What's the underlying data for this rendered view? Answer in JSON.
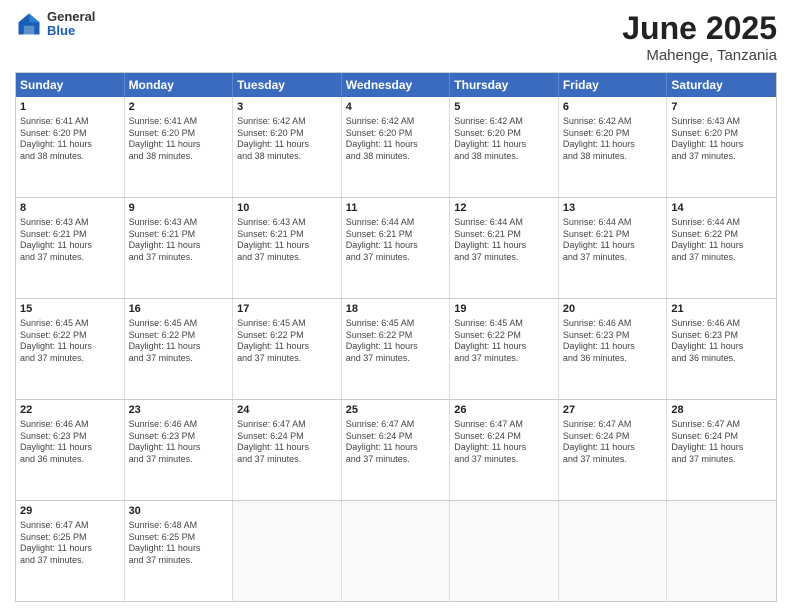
{
  "logo": {
    "general": "General",
    "blue": "Blue"
  },
  "title": {
    "month": "June 2025",
    "location": "Mahenge, Tanzania"
  },
  "header_days": [
    "Sunday",
    "Monday",
    "Tuesday",
    "Wednesday",
    "Thursday",
    "Friday",
    "Saturday"
  ],
  "weeks": [
    [
      {
        "day": "1",
        "lines": [
          "Sunrise: 6:41 AM",
          "Sunset: 6:20 PM",
          "Daylight: 11 hours",
          "and 38 minutes."
        ]
      },
      {
        "day": "2",
        "lines": [
          "Sunrise: 6:41 AM",
          "Sunset: 6:20 PM",
          "Daylight: 11 hours",
          "and 38 minutes."
        ]
      },
      {
        "day": "3",
        "lines": [
          "Sunrise: 6:42 AM",
          "Sunset: 6:20 PM",
          "Daylight: 11 hours",
          "and 38 minutes."
        ]
      },
      {
        "day": "4",
        "lines": [
          "Sunrise: 6:42 AM",
          "Sunset: 6:20 PM",
          "Daylight: 11 hours",
          "and 38 minutes."
        ]
      },
      {
        "day": "5",
        "lines": [
          "Sunrise: 6:42 AM",
          "Sunset: 6:20 PM",
          "Daylight: 11 hours",
          "and 38 minutes."
        ]
      },
      {
        "day": "6",
        "lines": [
          "Sunrise: 6:42 AM",
          "Sunset: 6:20 PM",
          "Daylight: 11 hours",
          "and 38 minutes."
        ]
      },
      {
        "day": "7",
        "lines": [
          "Sunrise: 6:43 AM",
          "Sunset: 6:20 PM",
          "Daylight: 11 hours",
          "and 37 minutes."
        ]
      }
    ],
    [
      {
        "day": "8",
        "lines": [
          "Sunrise: 6:43 AM",
          "Sunset: 6:21 PM",
          "Daylight: 11 hours",
          "and 37 minutes."
        ]
      },
      {
        "day": "9",
        "lines": [
          "Sunrise: 6:43 AM",
          "Sunset: 6:21 PM",
          "Daylight: 11 hours",
          "and 37 minutes."
        ]
      },
      {
        "day": "10",
        "lines": [
          "Sunrise: 6:43 AM",
          "Sunset: 6:21 PM",
          "Daylight: 11 hours",
          "and 37 minutes."
        ]
      },
      {
        "day": "11",
        "lines": [
          "Sunrise: 6:44 AM",
          "Sunset: 6:21 PM",
          "Daylight: 11 hours",
          "and 37 minutes."
        ]
      },
      {
        "day": "12",
        "lines": [
          "Sunrise: 6:44 AM",
          "Sunset: 6:21 PM",
          "Daylight: 11 hours",
          "and 37 minutes."
        ]
      },
      {
        "day": "13",
        "lines": [
          "Sunrise: 6:44 AM",
          "Sunset: 6:21 PM",
          "Daylight: 11 hours",
          "and 37 minutes."
        ]
      },
      {
        "day": "14",
        "lines": [
          "Sunrise: 6:44 AM",
          "Sunset: 6:22 PM",
          "Daylight: 11 hours",
          "and 37 minutes."
        ]
      }
    ],
    [
      {
        "day": "15",
        "lines": [
          "Sunrise: 6:45 AM",
          "Sunset: 6:22 PM",
          "Daylight: 11 hours",
          "and 37 minutes."
        ]
      },
      {
        "day": "16",
        "lines": [
          "Sunrise: 6:45 AM",
          "Sunset: 6:22 PM",
          "Daylight: 11 hours",
          "and 37 minutes."
        ]
      },
      {
        "day": "17",
        "lines": [
          "Sunrise: 6:45 AM",
          "Sunset: 6:22 PM",
          "Daylight: 11 hours",
          "and 37 minutes."
        ]
      },
      {
        "day": "18",
        "lines": [
          "Sunrise: 6:45 AM",
          "Sunset: 6:22 PM",
          "Daylight: 11 hours",
          "and 37 minutes."
        ]
      },
      {
        "day": "19",
        "lines": [
          "Sunrise: 6:45 AM",
          "Sunset: 6:22 PM",
          "Daylight: 11 hours",
          "and 37 minutes."
        ]
      },
      {
        "day": "20",
        "lines": [
          "Sunrise: 6:46 AM",
          "Sunset: 6:23 PM",
          "Daylight: 11 hours",
          "and 36 minutes."
        ]
      },
      {
        "day": "21",
        "lines": [
          "Sunrise: 6:46 AM",
          "Sunset: 6:23 PM",
          "Daylight: 11 hours",
          "and 36 minutes."
        ]
      }
    ],
    [
      {
        "day": "22",
        "lines": [
          "Sunrise: 6:46 AM",
          "Sunset: 6:23 PM",
          "Daylight: 11 hours",
          "and 36 minutes."
        ]
      },
      {
        "day": "23",
        "lines": [
          "Sunrise: 6:46 AM",
          "Sunset: 6:23 PM",
          "Daylight: 11 hours",
          "and 37 minutes."
        ]
      },
      {
        "day": "24",
        "lines": [
          "Sunrise: 6:47 AM",
          "Sunset: 6:24 PM",
          "Daylight: 11 hours",
          "and 37 minutes."
        ]
      },
      {
        "day": "25",
        "lines": [
          "Sunrise: 6:47 AM",
          "Sunset: 6:24 PM",
          "Daylight: 11 hours",
          "and 37 minutes."
        ]
      },
      {
        "day": "26",
        "lines": [
          "Sunrise: 6:47 AM",
          "Sunset: 6:24 PM",
          "Daylight: 11 hours",
          "and 37 minutes."
        ]
      },
      {
        "day": "27",
        "lines": [
          "Sunrise: 6:47 AM",
          "Sunset: 6:24 PM",
          "Daylight: 11 hours",
          "and 37 minutes."
        ]
      },
      {
        "day": "28",
        "lines": [
          "Sunrise: 6:47 AM",
          "Sunset: 6:24 PM",
          "Daylight: 11 hours",
          "and 37 minutes."
        ]
      }
    ],
    [
      {
        "day": "29",
        "lines": [
          "Sunrise: 6:47 AM",
          "Sunset: 6:25 PM",
          "Daylight: 11 hours",
          "and 37 minutes."
        ]
      },
      {
        "day": "30",
        "lines": [
          "Sunrise: 6:48 AM",
          "Sunset: 6:25 PM",
          "Daylight: 11 hours",
          "and 37 minutes."
        ]
      },
      {
        "day": "",
        "lines": []
      },
      {
        "day": "",
        "lines": []
      },
      {
        "day": "",
        "lines": []
      },
      {
        "day": "",
        "lines": []
      },
      {
        "day": "",
        "lines": []
      }
    ]
  ]
}
